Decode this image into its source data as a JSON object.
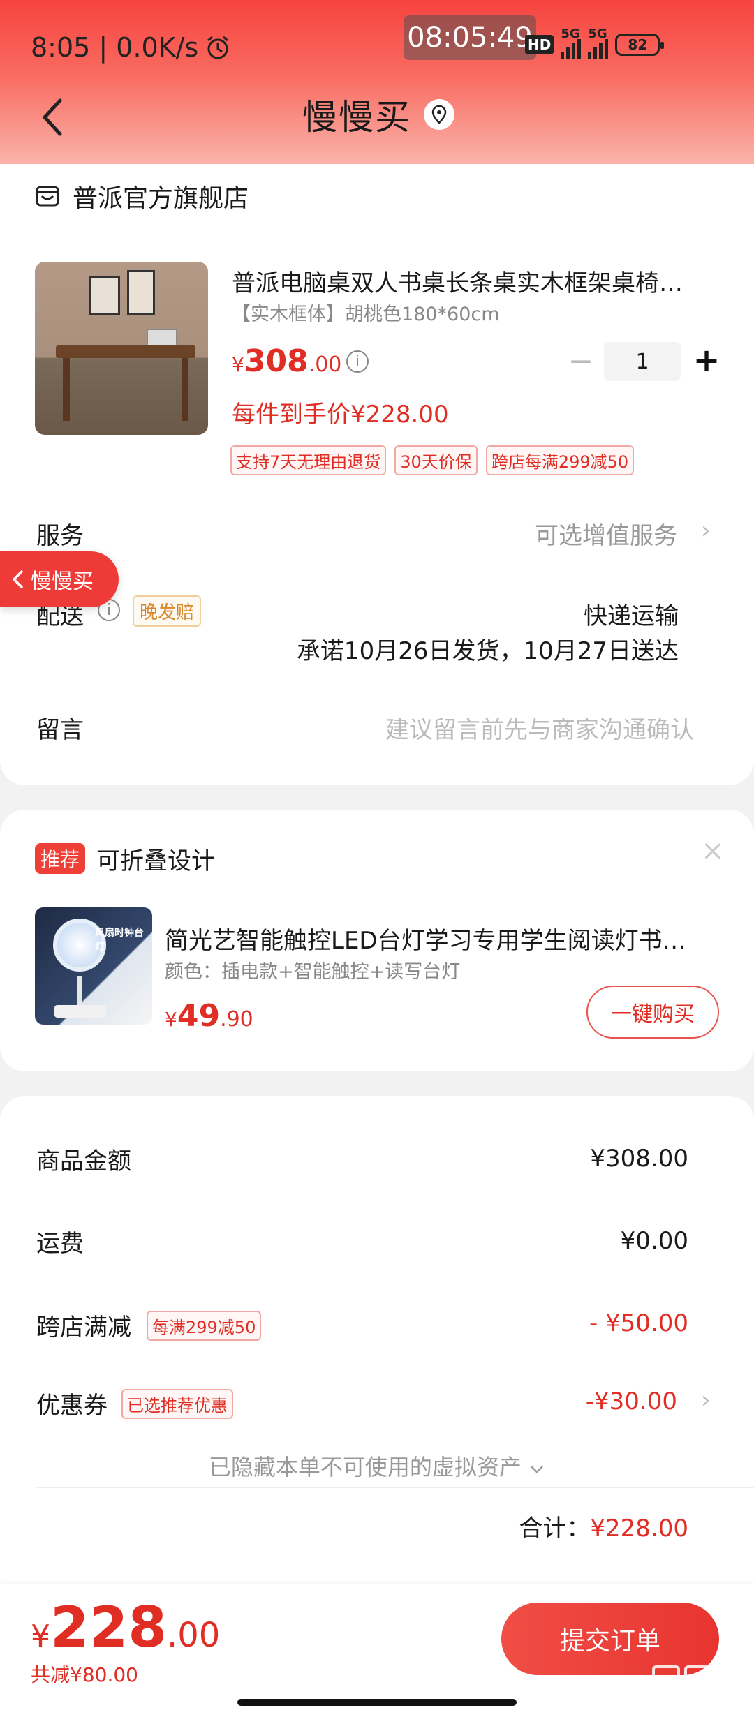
{
  "status_bar": {
    "left_text": "8:05 | 0.0K/s",
    "time_chip": "08:05:49",
    "hd": "HD",
    "net1": "5G",
    "net2": "5G",
    "battery": "82"
  },
  "header": {
    "title": "慢慢买"
  },
  "store": {
    "name": "普派官方旗舰店"
  },
  "product": {
    "title": "普派电脑桌双人书桌长条桌实木框架桌椅…",
    "spec": "【实木框体】胡桃色180*60cm",
    "price_symbol": "¥",
    "price_int": "308",
    "price_dec": ".00",
    "final_price": "每件到手价¥228.00",
    "quantity": "1",
    "tags": [
      "支持7天无理由退货",
      "30天价保",
      "跨店每满299减50"
    ]
  },
  "service": {
    "label": "服务",
    "value": "可选增值服务"
  },
  "floating_button": {
    "label": "慢慢买"
  },
  "delivery": {
    "label": "配送",
    "tag": "晚发赔",
    "method": "快递运输",
    "promise": "承诺10月26日发货，10月27日送达"
  },
  "message": {
    "label": "留言",
    "placeholder": "建议留言前先与商家沟通确认"
  },
  "recommendation": {
    "badge": "推荐",
    "title": "可折叠设计",
    "product_title": "简光艺智能触控LED台灯学习专用学生阅读灯书…",
    "product_spec": "颜色：插电款+智能触控+读写台灯",
    "price_symbol": "¥",
    "price_int": "49",
    "price_dec": ".90",
    "buy_label": "一键购买",
    "img_text": "风扇时钟台灯"
  },
  "summary": {
    "goods_label": "商品金额",
    "goods_value": "¥308.00",
    "shipping_label": "运费",
    "shipping_value": "¥0.00",
    "discount_label": "跨店满减",
    "discount_tag": "每满299减50",
    "discount_value": "- ¥50.00",
    "coupon_label": "优惠券",
    "coupon_tag": "已选推荐优惠",
    "coupon_value": "-¥30.00",
    "hidden_assets": "已隐藏本单不可使用的虚拟资产",
    "total_label": "合计：",
    "total_value": "¥228.00"
  },
  "bottom": {
    "price_symbol": "¥",
    "price_int": "228",
    "price_dec": ".00",
    "saved": "共减¥80.00",
    "submit": "提交订单"
  },
  "colors": {
    "accent": "#e02e24",
    "header_top": "#f7443f"
  }
}
